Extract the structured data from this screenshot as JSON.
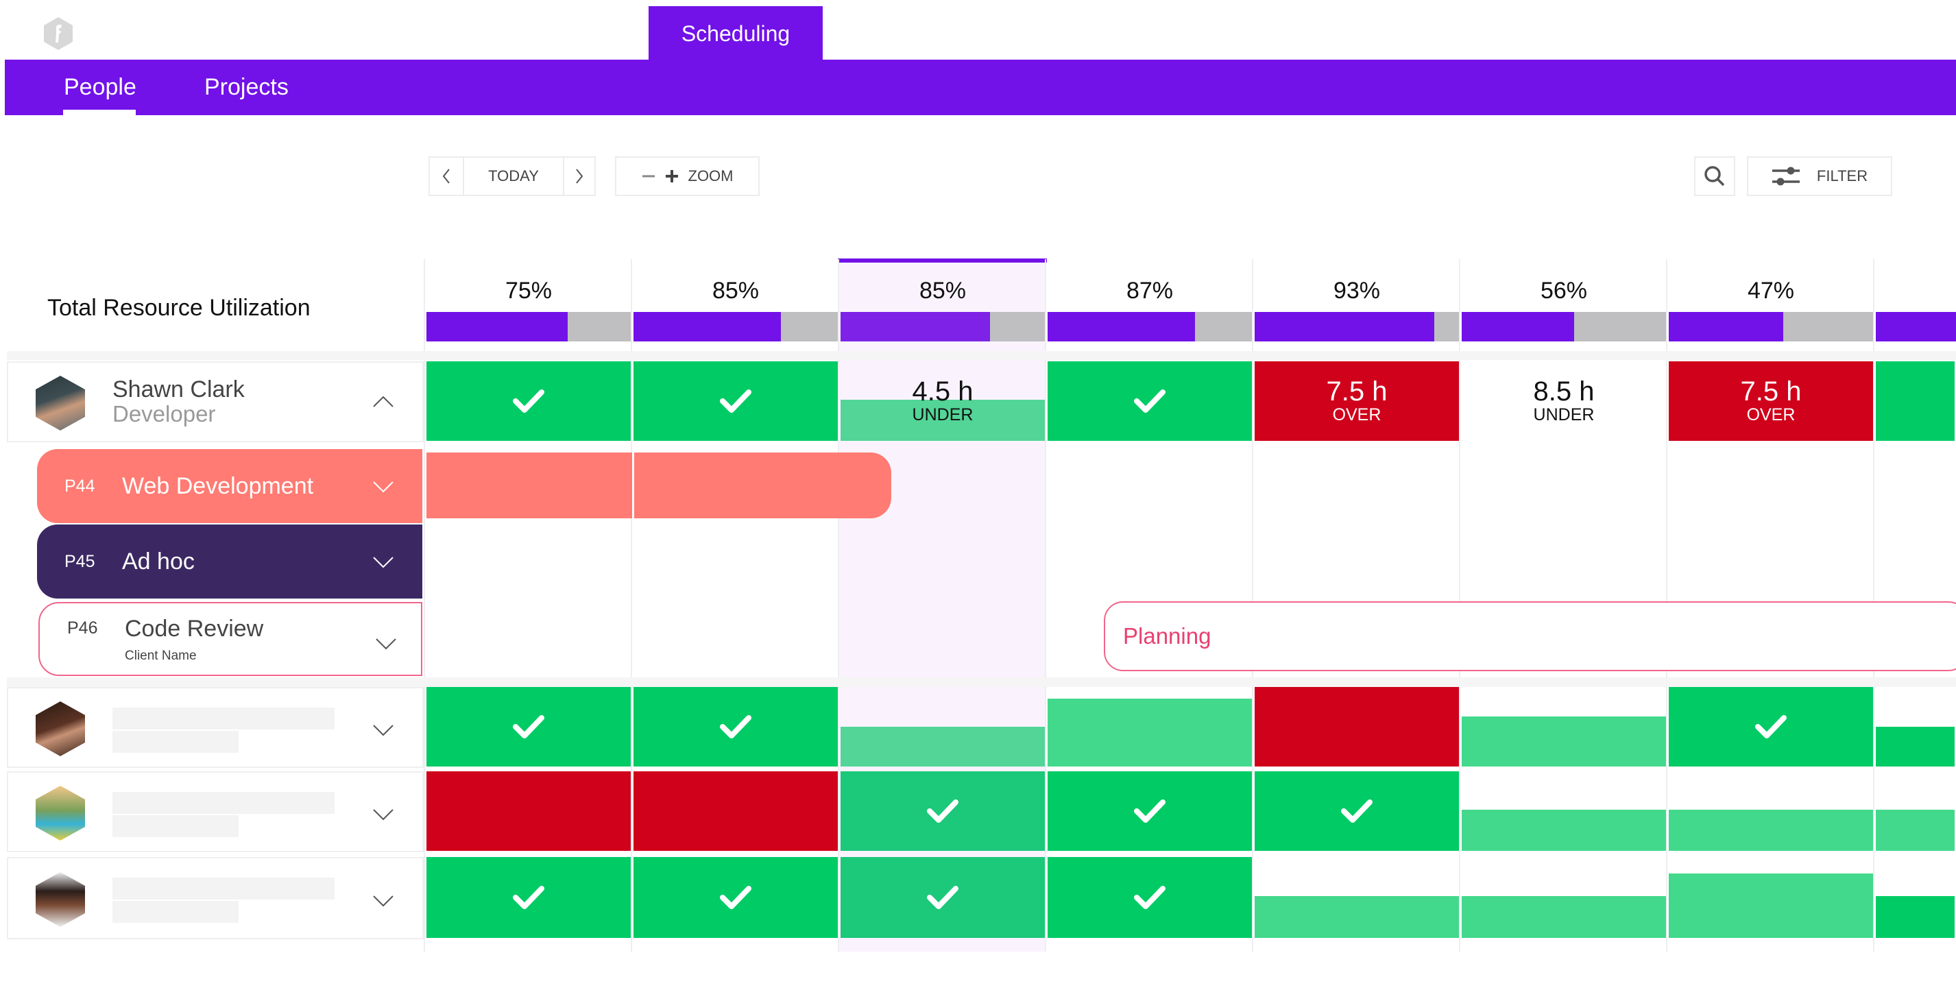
{
  "app": {
    "logo_icon": "hexagon-f-logo-icon",
    "active_app_tab": "Scheduling"
  },
  "nav": {
    "tabs": [
      {
        "label": "People",
        "active": true
      },
      {
        "label": "Projects",
        "active": false
      }
    ]
  },
  "toolbar": {
    "prev_icon": "chevron-left-icon",
    "today_label": "TODAY",
    "next_icon": "chevron-right-icon",
    "zoom_out_icon": "minus-icon",
    "zoom_in_icon": "plus-icon",
    "zoom_label": "ZOOM",
    "search_icon": "search-icon",
    "filter_icon": "sliders-icon",
    "filter_label": "FILTER"
  },
  "colors": {
    "brand": "#7211e8",
    "ok": "#00cb65",
    "ok_light": "#42d98c",
    "over": "#d0011b",
    "utilization_remaining": "#bfbfc1",
    "project_web_dev": "#ff7b73",
    "project_adhoc": "#3b2863",
    "project_code_review_border": "#f0668b",
    "today_column": "#faf3fd"
  },
  "utilization": {
    "label": "Total Resource Utilization",
    "columns": [
      {
        "pct_label": "75%",
        "fill": 0.69
      },
      {
        "pct_label": "85%",
        "fill": 0.72
      },
      {
        "pct_label": "85%",
        "fill": 0.73,
        "today": true
      },
      {
        "pct_label": "87%",
        "fill": 0.72
      },
      {
        "pct_label": "93%",
        "fill": 0.88
      },
      {
        "pct_label": "56%",
        "fill": 0.55
      },
      {
        "pct_label": "47%",
        "fill": 0.56
      },
      {
        "pct_label": "",
        "fill": 1.0
      }
    ]
  },
  "people": [
    {
      "name": "Shawn Clark",
      "role": "Developer",
      "expanded": true,
      "cells": [
        {
          "type": "check",
          "color": "ok",
          "fill": 1
        },
        {
          "type": "check",
          "color": "ok",
          "fill": 1
        },
        {
          "type": "hours",
          "color": "ok_light",
          "fill": 0.52,
          "hours": "4.5 h",
          "status": "UNDER"
        },
        {
          "type": "check",
          "color": "ok",
          "fill": 1
        },
        {
          "type": "hours",
          "color": "over",
          "fill": 1,
          "hours": "7.5 h",
          "status": "OVER"
        },
        {
          "type": "hours",
          "color": "none",
          "fill": 0,
          "hours": "8.5 h",
          "status": "UNDER"
        },
        {
          "type": "hours",
          "color": "over",
          "fill": 1,
          "hours": "7.5 h",
          "status": "OVER"
        },
        {
          "type": "plain",
          "color": "ok",
          "fill": 1
        }
      ],
      "projects": [
        {
          "code": "P44",
          "name": "Web Development",
          "client": "",
          "style": "web_dev",
          "timeline_label": ""
        },
        {
          "code": "P45",
          "name": "Ad hoc",
          "client": "",
          "style": "adhoc",
          "timeline_label": ""
        },
        {
          "code": "P46",
          "name": "Code Review",
          "client": "Client Name",
          "style": "code_review",
          "timeline_label": "Planning"
        }
      ]
    },
    {
      "name": "",
      "role": "",
      "expanded": false,
      "cells": [
        {
          "type": "check",
          "color": "ok",
          "fill": 1
        },
        {
          "type": "check",
          "color": "ok",
          "fill": 1
        },
        {
          "type": "plain",
          "color": "ok_light",
          "fill": 0.5
        },
        {
          "type": "plain",
          "color": "ok_light",
          "fill": 0.85
        },
        {
          "type": "plain",
          "color": "over",
          "fill": 1
        },
        {
          "type": "plain",
          "color": "ok_light",
          "fill": 0.63
        },
        {
          "type": "check",
          "color": "ok",
          "fill": 1
        },
        {
          "type": "plain",
          "color": "ok",
          "fill": 0.5
        }
      ]
    },
    {
      "name": "",
      "role": "",
      "expanded": false,
      "cells": [
        {
          "type": "plain",
          "color": "over",
          "fill": 1
        },
        {
          "type": "plain",
          "color": "over",
          "fill": 1
        },
        {
          "type": "check",
          "color": "ok",
          "fill": 1
        },
        {
          "type": "check",
          "color": "ok",
          "fill": 1
        },
        {
          "type": "check",
          "color": "ok",
          "fill": 1
        },
        {
          "type": "plain",
          "color": "ok_light",
          "fill": 0.52
        },
        {
          "type": "plain",
          "color": "ok_light",
          "fill": 0.52
        },
        {
          "type": "plain",
          "color": "ok_light",
          "fill": 0.52
        }
      ]
    },
    {
      "name": "",
      "role": "",
      "expanded": false,
      "cells": [
        {
          "type": "check",
          "color": "ok",
          "fill": 1
        },
        {
          "type": "check",
          "color": "ok",
          "fill": 1
        },
        {
          "type": "check",
          "color": "ok",
          "fill": 1
        },
        {
          "type": "check",
          "color": "ok",
          "fill": 1
        },
        {
          "type": "plain",
          "color": "ok_light",
          "fill": 0.52
        },
        {
          "type": "plain",
          "color": "ok_light",
          "fill": 0.52
        },
        {
          "type": "plain",
          "color": "ok_light",
          "fill": 0.8
        },
        {
          "type": "plain",
          "color": "ok",
          "fill": 0.52
        }
      ]
    }
  ]
}
